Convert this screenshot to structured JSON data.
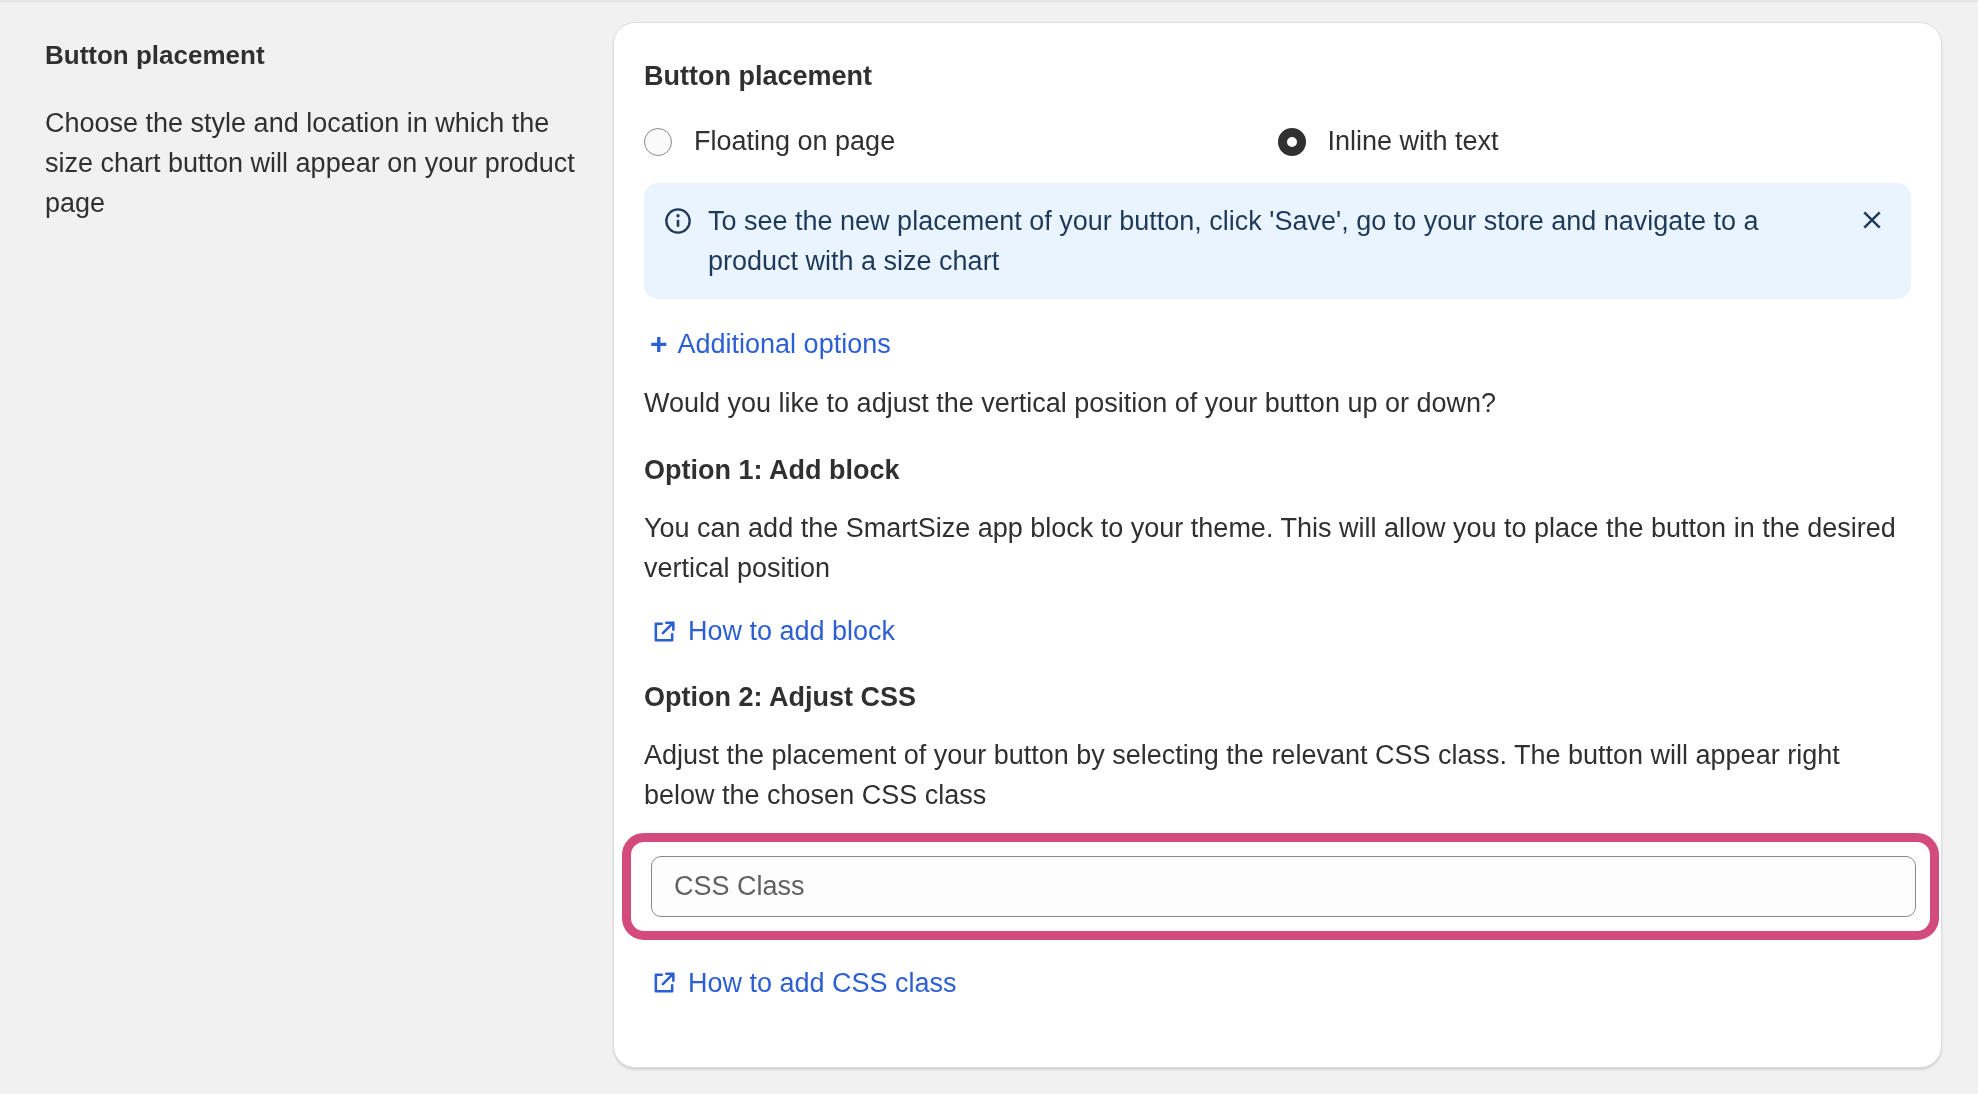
{
  "intro": {
    "title": "Button placement",
    "description": "Choose the style and location in which the size chart button will appear on your product page"
  },
  "card": {
    "title": "Button placement",
    "placement_options": [
      {
        "label": "Floating on page",
        "selected": false
      },
      {
        "label": "Inline with text",
        "selected": true
      }
    ],
    "info_banner": {
      "text": "To see the new placement of your button, click 'Save', go to your store and navigate to a product with a size chart"
    },
    "additional_options_link": {
      "icon": "+",
      "label": "Additional options"
    },
    "question": "Would you like to adjust the vertical position of your button up or down?",
    "options": [
      {
        "title": "Option 1: Add block",
        "text": "You can add the SmartSize app block to your theme. This will allow you to place the button in the desired vertical position",
        "link": "How to add block",
        "kind": "link"
      },
      {
        "title": "Option 2: Adjust CSS",
        "text": "Adjust the placement of your button by selecting the relevant CSS class. The button will appear right below the chosen CSS class",
        "field": {
          "placeholder": "CSS Class",
          "highlighted": true
        },
        "link": "How to add CSS class",
        "kind": "field"
      }
    ]
  }
}
